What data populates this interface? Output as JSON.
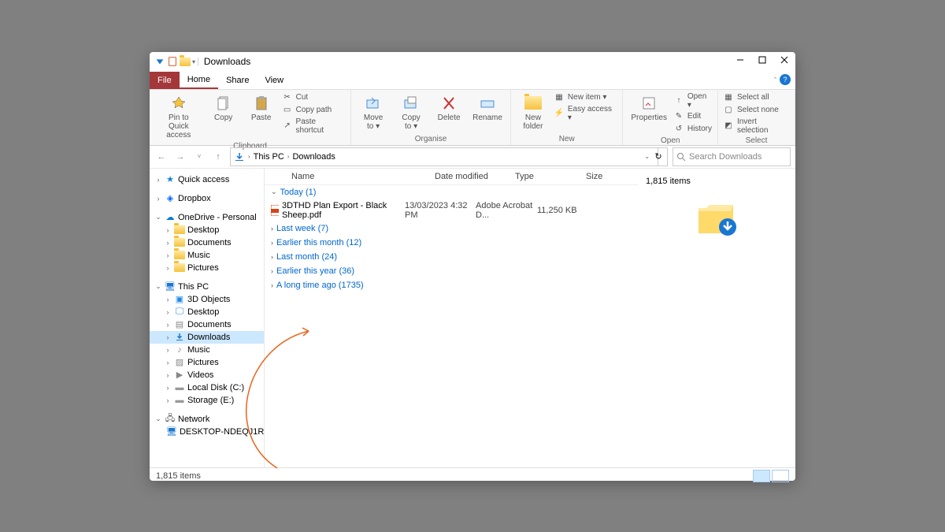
{
  "window_title": "Downloads",
  "tabs": {
    "file": "File",
    "home": "Home",
    "share": "Share",
    "view": "View"
  },
  "ribbon": {
    "pin": "Pin to Quick\naccess",
    "copy": "Copy",
    "paste": "Paste",
    "cut": "Cut",
    "copypath": "Copy path",
    "pasteshort": "Paste shortcut",
    "clipboard": "Clipboard",
    "moveto": "Move\nto ▾",
    "copyto": "Copy\nto ▾",
    "delete": "Delete",
    "rename": "Rename",
    "organise": "Organise",
    "newfolder": "New\nfolder",
    "newitem": "New item ▾",
    "easyaccess": "Easy access ▾",
    "new": "New",
    "properties": "Properties",
    "open": "Open ▾",
    "edit": "Edit",
    "history": "History",
    "opengrp": "Open",
    "selall": "Select all",
    "selnone": "Select none",
    "invsel": "Invert selection",
    "select": "Select"
  },
  "breadcrumbs": {
    "thispc": "This PC",
    "downloads": "Downloads"
  },
  "search_placeholder": "Search Downloads",
  "tree": {
    "quick": "Quick access",
    "dropbox": "Dropbox",
    "onedrive": "OneDrive - Personal",
    "od_desktop": "Desktop",
    "od_documents": "Documents",
    "od_music": "Music",
    "od_pictures": "Pictures",
    "thispc": "This PC",
    "pc_3d": "3D Objects",
    "pc_desktop": "Desktop",
    "pc_documents": "Documents",
    "pc_downloads": "Downloads",
    "pc_music": "Music",
    "pc_pictures": "Pictures",
    "pc_videos": "Videos",
    "pc_c": "Local Disk (C:)",
    "pc_e": "Storage (E:)",
    "network": "Network",
    "net_pc": "DESKTOP-NDEQJ1R"
  },
  "columns": {
    "name": "Name",
    "date": "Date modified",
    "type": "Type",
    "size": "Size"
  },
  "groups": {
    "today": "Today (1)",
    "lastweek": "Last week (7)",
    "earliermonth": "Earlier this month (12)",
    "lastmonth": "Last month (24)",
    "earlieryear": "Earlier this year (36)",
    "longago": "A long time ago (1735)"
  },
  "file": {
    "name": "3DTHD Plan Export - Black Sheep.pdf",
    "date": "13/03/2023 4:32 PM",
    "type": "Adobe Acrobat D...",
    "size": "11,250 KB"
  },
  "preview": {
    "count": "1,815 items"
  },
  "status": {
    "count": "1,815 items"
  }
}
